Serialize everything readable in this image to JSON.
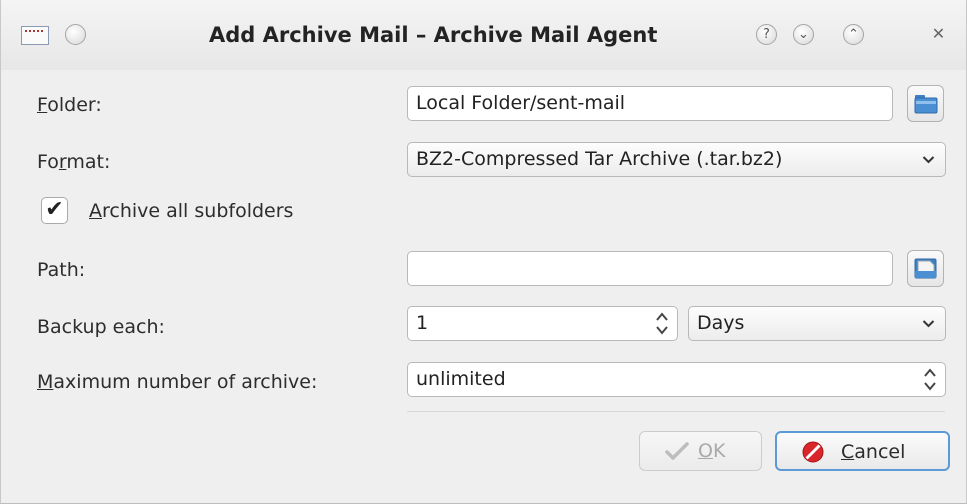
{
  "window": {
    "title": "Add Archive Mail – Archive Mail Agent",
    "help_glyph": "?",
    "minimize_glyph": "⌄",
    "maximize_glyph": "⌃",
    "close_glyph": "✕"
  },
  "form": {
    "folder": {
      "label_pre": "",
      "label_mnemonic": "F",
      "label_post": "older:",
      "value": "Local Folder/sent-mail"
    },
    "format": {
      "label_pre": "Fo",
      "label_mnemonic": "r",
      "label_post": "mat:",
      "value": "BZ2-Compressed Tar Archive (.tar.bz2)"
    },
    "subfolders": {
      "checked_glyph": "✔",
      "label_mnemonic": "A",
      "label_post": "rchive all subfolders"
    },
    "path": {
      "label": "Path:",
      "value": ""
    },
    "backup": {
      "label": "Backup each:",
      "value": "1",
      "unit": "Days"
    },
    "maximum": {
      "label_mnemonic": "M",
      "label_post": "aximum number of archive:",
      "value": "unlimited"
    }
  },
  "buttons": {
    "ok": {
      "label_mnemonic": "O",
      "label_post": "K"
    },
    "cancel": {
      "label_mnemonic": "C",
      "label_post": "ancel"
    }
  },
  "colors": {
    "accent": "#5b9ad6",
    "cancel_icon": "#d8262a",
    "ok_check_disabled": "#bdbdbd"
  },
  "icons": {
    "app": "mail-envelope-icon",
    "folder_browse": "folder-icon",
    "path_browse": "document-icon",
    "ok": "checkmark-icon",
    "cancel": "cancel-icon"
  }
}
